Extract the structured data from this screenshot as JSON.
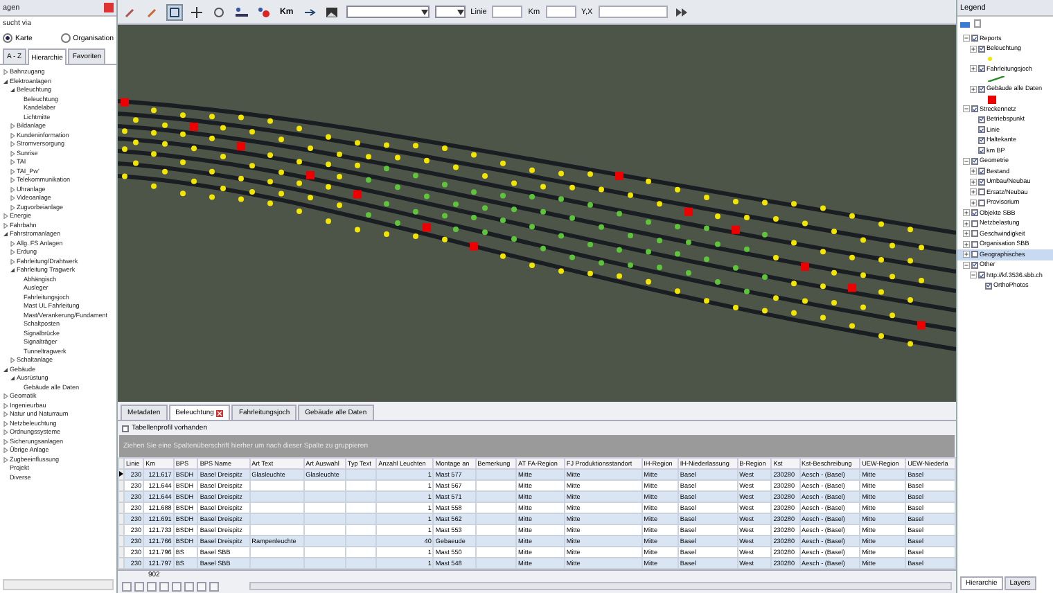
{
  "left_panel": {
    "title": "agen",
    "search_via_label": "sucht via",
    "search_options": [
      {
        "label": "Karte",
        "selected": true
      },
      {
        "label": "Organisation",
        "selected": false
      }
    ],
    "tabs": [
      {
        "label": "A - Z",
        "selected": false
      },
      {
        "label": "Hierarchie",
        "selected": true
      },
      {
        "label": "Favoriten",
        "selected": false
      }
    ],
    "tree": [
      {
        "label": "Bahnzugang",
        "expanded": false
      },
      {
        "label": "Elektroanlagen",
        "expanded": true,
        "children": [
          {
            "label": "Beleuchtung",
            "expanded": true,
            "children": [
              {
                "label": "Beleuchtung"
              },
              {
                "label": "Kandelaber"
              },
              {
                "label": "Lichtmitte"
              }
            ]
          },
          {
            "label": "Bildanlage",
            "expanded": false
          },
          {
            "label": "Kundeninformation",
            "expanded": false
          },
          {
            "label": "Stromversorgung",
            "expanded": false
          },
          {
            "label": "Sunrise",
            "expanded": false
          },
          {
            "label": "TAI",
            "expanded": false
          },
          {
            "label": "TAI_Pw'",
            "expanded": false
          },
          {
            "label": "Telekommunikation",
            "expanded": false
          },
          {
            "label": "Uhranlage",
            "expanded": false
          },
          {
            "label": "Videoanlage",
            "expanded": false
          },
          {
            "label": "Zugvorbeianlage",
            "expanded": false
          }
        ]
      },
      {
        "label": "Energie",
        "expanded": false
      },
      {
        "label": "Fahrbahn",
        "expanded": false
      },
      {
        "label": "Fahrstromanlagen",
        "expanded": true,
        "children": [
          {
            "label": "Allg. FS Anlagen",
            "expanded": false
          },
          {
            "label": "Erdung",
            "expanded": false
          },
          {
            "label": "Fahrleitung/Drahtwerk",
            "expanded": false
          },
          {
            "label": "Fahrleitung Tragwerk",
            "expanded": true,
            "children": [
              {
                "label": "Abhängisch"
              },
              {
                "label": "Ausleger"
              },
              {
                "label": "Fahrleitungsjoch"
              },
              {
                "label": "Mast UL Fahrleitung"
              },
              {
                "label": "Mast/Verankerung/Fundament"
              },
              {
                "label": "Schaltposten"
              },
              {
                "label": "Signalbrücke"
              },
              {
                "label": "Signalträger"
              },
              {
                "label": "Tunneltragwerk"
              }
            ]
          },
          {
            "label": "Schaltanlage",
            "expanded": false
          }
        ]
      },
      {
        "label": "Gebäude",
        "expanded": true,
        "children": [
          {
            "label": "Ausrüstung",
            "expanded": true,
            "children": [
              {
                "label": "Gebäude alle Daten"
              }
            ]
          }
        ]
      },
      {
        "label": "Geomatik",
        "expanded": false
      },
      {
        "label": "Ingenieurbau",
        "expanded": false
      },
      {
        "label": "Natur und Naturraum",
        "expanded": false
      },
      {
        "label": "Netzbeleuchtung",
        "expanded": false
      },
      {
        "label": "Ordnungssysteme",
        "expanded": false
      },
      {
        "label": "Sicherungsanlagen",
        "expanded": false
      },
      {
        "label": "Übrige Anlage",
        "expanded": false
      },
      {
        "label": "Zugbeeinflussung",
        "expanded": false
      },
      {
        "label": "Projekt"
      },
      {
        "label": "Diverse"
      }
    ]
  },
  "toolbar": {
    "km_button": "Km",
    "fields": [
      {
        "label": "Linie"
      },
      {
        "label": "Km"
      },
      {
        "label": "Y,X"
      }
    ]
  },
  "table_panel": {
    "tabs": [
      {
        "label": "Metadaten",
        "selected": false
      },
      {
        "label": "Beleuchtung",
        "selected": true
      },
      {
        "label": "Fahrleitungsjoch",
        "selected": false
      },
      {
        "label": "Gebäude alle Daten",
        "selected": false
      }
    ],
    "profile_checkbox": {
      "label": "Tabellenprofil vorhanden",
      "checked": false
    },
    "group_hint": "Ziehen Sie eine Spaltenüberschrift hierher um nach dieser Spalte zu gruppieren",
    "columns": [
      "Linie",
      "Km",
      "BPS",
      "BPS Name",
      "Art Text",
      "Art Auswahl",
      "Typ Text",
      "Anzahl Leuchten",
      "Montage an",
      "Bemerkung",
      "AT FA-Region",
      "FJ Produktionsstandort",
      "IH-Region",
      "IH-Niederlassung",
      "B-Region",
      "Kst",
      "Kst-Beschreibung",
      "UEW-Region",
      "UEW-Niederla"
    ],
    "rows": [
      {
        "selected": true,
        "cells": [
          "230",
          "121.617",
          "BSDH",
          "Basel Dreispitz",
          "Glasleuchte",
          "Glasleuchte",
          "",
          "1",
          "Mast 577",
          "",
          "Mitte",
          "Mitte",
          "Mitte",
          "Basel",
          "West",
          "230280",
          "Aesch - (Basel)",
          "Mitte",
          "Basel"
        ]
      },
      {
        "selected": false,
        "cells": [
          "230",
          "121.644",
          "BSDH",
          "Basel Dreispitz",
          "",
          "",
          "",
          "1",
          "Mast 567",
          "",
          "Mitte",
          "Mitte",
          "Mitte",
          "Basel",
          "West",
          "230280",
          "Aesch - (Basel)",
          "Mitte",
          "Basel"
        ]
      },
      {
        "selected": false,
        "cells": [
          "230",
          "121.644",
          "BSDH",
          "Basel Dreispitz",
          "",
          "",
          "",
          "1",
          "Mast 571",
          "",
          "Mitte",
          "Mitte",
          "Mitte",
          "Basel",
          "West",
          "230280",
          "Aesch - (Basel)",
          "Mitte",
          "Basel"
        ]
      },
      {
        "selected": false,
        "cells": [
          "230",
          "121.688",
          "BSDH",
          "Basel Dreispitz",
          "",
          "",
          "",
          "1",
          "Mast 558",
          "",
          "Mitte",
          "Mitte",
          "Mitte",
          "Basel",
          "West",
          "230280",
          "Aesch - (Basel)",
          "Mitte",
          "Basel"
        ]
      },
      {
        "selected": false,
        "cells": [
          "230",
          "121.691",
          "BSDH",
          "Basel Dreispitz",
          "",
          "",
          "",
          "1",
          "Mast 562",
          "",
          "Mitte",
          "Mitte",
          "Mitte",
          "Basel",
          "West",
          "230280",
          "Aesch - (Basel)",
          "Mitte",
          "Basel"
        ]
      },
      {
        "selected": false,
        "cells": [
          "230",
          "121.733",
          "BSDH",
          "Basel Dreispitz",
          "",
          "",
          "",
          "1",
          "Mast 553",
          "",
          "Mitte",
          "Mitte",
          "Mitte",
          "Basel",
          "West",
          "230280",
          "Aesch - (Basel)",
          "Mitte",
          "Basel"
        ]
      },
      {
        "selected": false,
        "cells": [
          "230",
          "121.766",
          "BSDH",
          "Basel Dreispitz",
          "Rampenleuchte",
          "",
          "",
          "40",
          "Gebaeude",
          "",
          "Mitte",
          "Mitte",
          "Mitte",
          "Basel",
          "West",
          "230280",
          "Aesch - (Basel)",
          "Mitte",
          "Basel"
        ]
      },
      {
        "selected": false,
        "cells": [
          "230",
          "121.796",
          "BS",
          "Basel SBB",
          "",
          "",
          "",
          "1",
          "Mast 550",
          "",
          "Mitte",
          "Mitte",
          "Mitte",
          "Basel",
          "West",
          "230280",
          "Aesch - (Basel)",
          "Mitte",
          "Basel"
        ]
      },
      {
        "selected": false,
        "cells": [
          "230",
          "121.797",
          "BS",
          "Basel SBB",
          "",
          "",
          "",
          "1",
          "Mast 548",
          "",
          "Mitte",
          "Mitte",
          "Mitte",
          "Basel",
          "West",
          "230280",
          "Aesch - (Basel)",
          "Mitte",
          "Basel"
        ]
      }
    ],
    "footer_count": "902"
  },
  "legend": {
    "title": "Legend",
    "tree": [
      {
        "label": "Reports",
        "checked": true,
        "expanded": true,
        "children": [
          {
            "label": "Beleuchtung",
            "checked": true,
            "expanded": false,
            "symbol": {
              "kind": "point",
              "color": "#f2e600"
            }
          },
          {
            "label": "Fahrleitungsjoch",
            "checked": true,
            "expanded": false,
            "symbol": {
              "kind": "line",
              "color": "#2a8a2a"
            }
          },
          {
            "label": "Gebäude alle Daten",
            "checked": true,
            "expanded": false,
            "symbol": {
              "kind": "square",
              "color": "#ee0000"
            }
          }
        ]
      },
      {
        "label": "Streckennetz",
        "checked": true,
        "expanded": true,
        "children": [
          {
            "label": "Betriebspunkt",
            "checked": true
          },
          {
            "label": "Linie",
            "checked": true
          },
          {
            "label": "Haltekante",
            "checked": true
          },
          {
            "label": "km BP",
            "checked": true
          }
        ]
      },
      {
        "label": "Geometrie",
        "checked": true,
        "expanded": true,
        "children": [
          {
            "label": "Bestand",
            "checked": true,
            "expanded": false
          },
          {
            "label": "Umbau/Neubau",
            "checked": true,
            "expanded": false
          },
          {
            "label": "Ersatz/Neubau",
            "checked": false,
            "expanded": false
          },
          {
            "label": "Provisorium",
            "checked": false,
            "expanded": false
          }
        ]
      },
      {
        "label": "Objekte SBB",
        "checked": true,
        "expanded": false
      },
      {
        "label": "Netzbelastung",
        "checked": false,
        "expanded": false
      },
      {
        "label": "Geschwindigkeit",
        "checked": false,
        "expanded": false
      },
      {
        "label": "Organisation SBB",
        "checked": false,
        "expanded": false
      },
      {
        "label": "Geographisches",
        "checked": false,
        "expanded": false,
        "selected": true
      },
      {
        "label": "Other",
        "checked": true,
        "expanded": true,
        "children": [
          {
            "label": "http://kf.3536.sbb.ch",
            "checked": true,
            "expanded": true,
            "children": [
              {
                "label": "OrthoPhotos",
                "checked": true
              }
            ]
          }
        ]
      }
    ],
    "bottom_tabs": [
      {
        "label": "Hierarchie",
        "selected": true
      },
      {
        "label": "Layers",
        "selected": false
      }
    ]
  }
}
